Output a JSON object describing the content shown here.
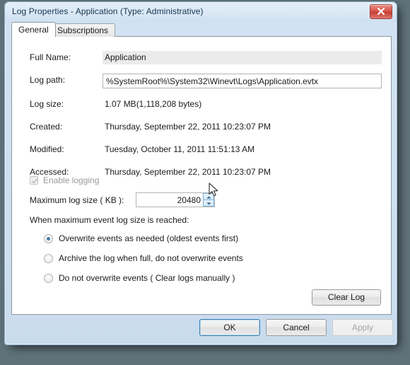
{
  "window": {
    "title": "Log Properties - Application (Type: Administrative)",
    "close_label": "Close"
  },
  "tabs": [
    {
      "label": "General",
      "active": true
    },
    {
      "label": "Subscriptions",
      "active": false
    }
  ],
  "general": {
    "rows": [
      {
        "label": "Full Name:",
        "value": "Application"
      },
      {
        "label": "Log path:",
        "value": "%SystemRoot%\\System32\\Winevt\\Logs\\Application.evtx"
      },
      {
        "label": "Log size:",
        "value": "1.07 MB(1,118,208 bytes)"
      },
      {
        "label": "Created:",
        "value": "Thursday, September 22, 2011 10:23:07 PM"
      },
      {
        "label": "Modified:",
        "value": "Tuesday, October 11, 2011 11:51:13 AM"
      },
      {
        "label": "Accessed:",
        "value": "Thursday, September 22, 2011 10:23:07 PM"
      }
    ],
    "enable_logging": {
      "label": "Enable logging",
      "checked": true,
      "disabled": true
    },
    "max_log_size": {
      "label": "Maximum log size ( KB ):",
      "value": "20480"
    },
    "when_full_label": "When maximum event log size is reached:",
    "overwrite_options": [
      {
        "label": "Overwrite events as needed (oldest events first)",
        "selected": true
      },
      {
        "label": "Archive the log when full, do not overwrite events",
        "selected": false
      },
      {
        "label": "Do not overwrite events ( Clear logs manually )",
        "selected": false
      }
    ],
    "clear_log_label": "Clear Log"
  },
  "footer": {
    "ok_label": "OK",
    "cancel_label": "Cancel",
    "apply_label": "Apply",
    "apply_disabled": true
  },
  "colors": {
    "accent": "#3c7fb1",
    "frame": "#cfe0f0",
    "close_red": "#d9564c",
    "desktop": "#5f7279"
  }
}
